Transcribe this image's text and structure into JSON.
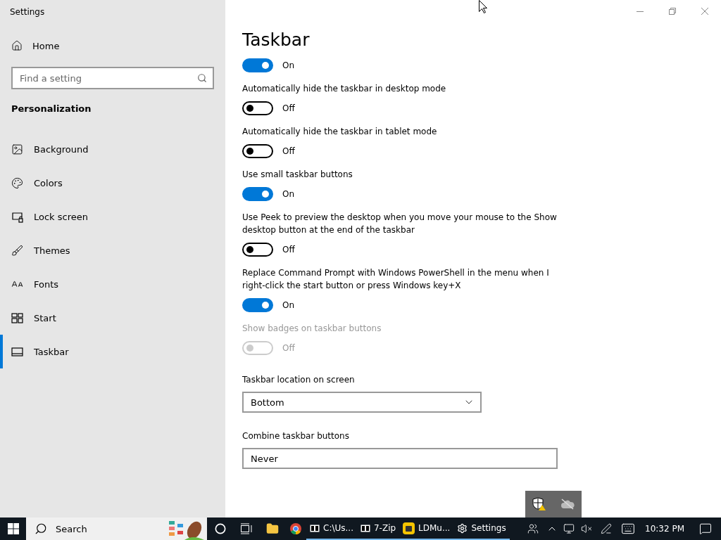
{
  "window": {
    "title": "Settings"
  },
  "sidebar": {
    "home": "Home",
    "search": {
      "placeholder": "Find a setting"
    },
    "section": "Personalization",
    "items": [
      {
        "label": "Background",
        "selected": false
      },
      {
        "label": "Colors",
        "selected": false
      },
      {
        "label": "Lock screen",
        "selected": false
      },
      {
        "label": "Themes",
        "selected": false
      },
      {
        "label": "Fonts",
        "selected": false
      },
      {
        "label": "Start",
        "selected": false
      },
      {
        "label": "Taskbar",
        "selected": true
      }
    ]
  },
  "page": {
    "title": "Taskbar",
    "settings": [
      {
        "kind": "toggle",
        "on": true,
        "disabled": false,
        "state_text": "On"
      },
      {
        "kind": "toggle",
        "label": "Automatically hide the taskbar in desktop mode",
        "on": false,
        "disabled": false,
        "state_text": "Off"
      },
      {
        "kind": "toggle",
        "label": "Automatically hide the taskbar in tablet mode",
        "on": false,
        "disabled": false,
        "state_text": "Off"
      },
      {
        "kind": "toggle",
        "label": "Use small taskbar buttons",
        "on": true,
        "disabled": false,
        "state_text": "On"
      },
      {
        "kind": "toggle",
        "label": "Use Peek to preview the desktop when you move your mouse to the Show desktop button at the end of the taskbar",
        "on": false,
        "disabled": false,
        "state_text": "Off"
      },
      {
        "kind": "toggle",
        "label": "Replace Command Prompt with Windows PowerShell in the menu when I right-click the start button or press Windows key+X",
        "on": true,
        "disabled": false,
        "state_text": "On"
      },
      {
        "kind": "toggle",
        "label": "Show badges on taskbar buttons",
        "on": false,
        "disabled": true,
        "state_text": "Off"
      },
      {
        "kind": "dropdown",
        "label": "Taskbar location on screen",
        "value": "Bottom"
      },
      {
        "kind": "dropdown",
        "label": "Combine taskbar buttons",
        "value": "Never"
      }
    ]
  },
  "taskbar": {
    "search": "Search",
    "apps": [
      {
        "label": "C:\\Us...",
        "running": true
      },
      {
        "label": "7-Zip",
        "running": true
      },
      {
        "label": "LDMu...",
        "running": true
      },
      {
        "label": "Settings",
        "running": true
      }
    ],
    "clock": "10:32 PM"
  }
}
